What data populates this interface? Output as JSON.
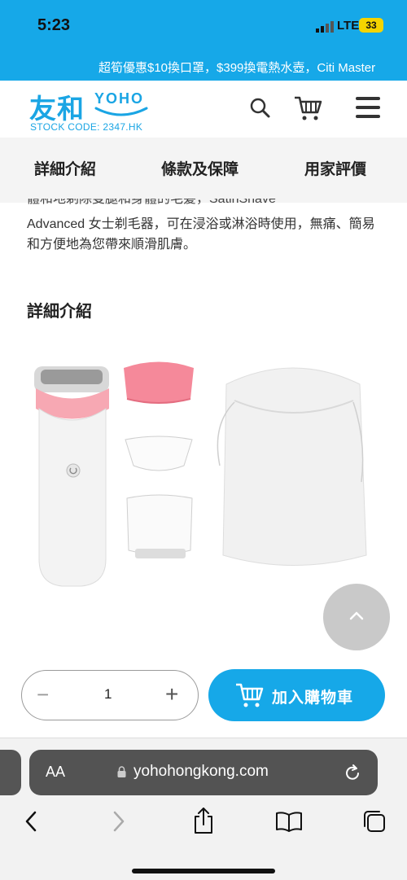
{
  "status": {
    "time": "5:23",
    "network": "LTE",
    "battery": "33"
  },
  "promo": {
    "text": "超筍優惠$10換口罩，$399換電熱水壺，Citi Master"
  },
  "header": {
    "logo_cn": "友和",
    "logo_en": "YOHO",
    "stock_code": "STOCK CODE: 2347.HK",
    "icons": [
      "search-icon",
      "cart-icon",
      "menu-icon"
    ]
  },
  "tabs": [
    "詳細介紹",
    "條款及保障",
    "用家評價"
  ],
  "content": {
    "cut_line": "體和地剃除雙腿和身體的毛髮，SatinShave",
    "description": "Advanced 女士剃毛器，可在浸浴或淋浴時使用，無痛、簡易和方便地為您帶來順滑肌膚。",
    "section_title": "詳細介紹"
  },
  "purchase": {
    "quantity": "1",
    "minus": "−",
    "plus": "+",
    "add_to_cart": "加入購物車"
  },
  "browser": {
    "aa": "AA",
    "url": "yohohongkong.com",
    "nav": [
      "back-icon",
      "forward-icon",
      "share-icon",
      "bookmarks-icon",
      "tabs-icon"
    ]
  },
  "colors": {
    "brand": "#16a8e8",
    "pink": "#f7a8b3"
  }
}
